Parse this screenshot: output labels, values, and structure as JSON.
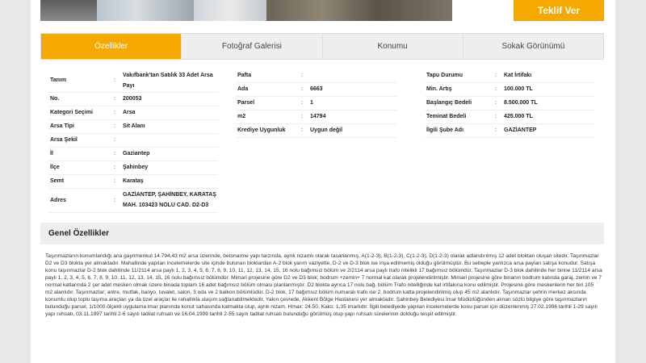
{
  "header": {
    "offer_button": "Teklif Ver"
  },
  "tabs": [
    {
      "label": "Özellikler",
      "active": true
    },
    {
      "label": "Fotoğraf Galerisi",
      "active": false
    },
    {
      "label": "Konumu",
      "active": false
    },
    {
      "label": "Sokak Görünümü",
      "active": false
    }
  ],
  "details_col1": [
    {
      "key": "Tanım",
      "sep": ":",
      "value": "Vakıfbank'tan Satılık 33 Adet Arsa Payı"
    },
    {
      "key": "No.",
      "sep": ":",
      "value": "200053"
    },
    {
      "key": "Kategori Seçimi",
      "sep": ":",
      "value": "Arsa"
    },
    {
      "key": "Arsa Tipi",
      "sep": ":",
      "value": "Sit Alanı"
    },
    {
      "key": "Arsa Şekil",
      "sep": ":",
      "value": ""
    },
    {
      "key": "İl",
      "sep": ":",
      "value": "Gaziantep"
    },
    {
      "key": "İlçe",
      "sep": ":",
      "value": "Şahinbey"
    },
    {
      "key": "Semt",
      "sep": ":",
      "value": "Karataş"
    },
    {
      "key": "Adres",
      "sep": ":",
      "value": "GAZİANTEP, ŞAHİNBEY, KARATAŞ MAH. 103423 NOLU CAD. D2-D3"
    }
  ],
  "details_col2": [
    {
      "key": "Pafta",
      "sep": ":",
      "value": ""
    },
    {
      "key": "Ada",
      "sep": ":",
      "value": "6663"
    },
    {
      "key": "Parsel",
      "sep": ":",
      "value": "1"
    },
    {
      "key": "m2",
      "sep": ":",
      "value": "14794"
    },
    {
      "key": "Krediye Uygunluk",
      "sep": ":",
      "value": "Uygun değil"
    }
  ],
  "details_col3": [
    {
      "key": "Tapu Durumu",
      "sep": ":",
      "value": "Kat İrtifakı"
    },
    {
      "key": "Min. Artış",
      "sep": ":",
      "value": "100.000 TL"
    },
    {
      "key": "Başlangıç Bedeli",
      "sep": ":",
      "value": "8.500.000 TL"
    },
    {
      "key": "Teminat Bedeli",
      "sep": ":",
      "value": "425.000 TL"
    },
    {
      "key": "İlgili Şube Adı",
      "sep": ":",
      "value": "GAZİANTEP"
    }
  ],
  "general": {
    "title": "Genel Özellikler",
    "description": "Taşınmazların konumlandığı ana gayrimenkul 14.794,43 m2 arsa üzerinde, betonarme yapı tarzında, ayrık nizamlı olarak tasarlanmış, A(1-2-3), B(1-2-3), C(1-2-3), D(1-2-3) olarak adlandırılmış 12 adet bloktan oluşan sitedir. Taşınmazlar D2 ve D3 blokta yer almaktadır. Mahallinde yapılan incelemelerde site içinde bulunan bloklardan A-2 blok yarım vaziyette, D-2 ve D-3 blok ise inşa edilmemiş olduğu görülmüştür. Bu sebeple yanlızca arsa payları satışa konudur. Satışa konu taşınmazlar D-2 blok dahilinde 11/2114 arsa paylı 1, 2, 3, 4, 5, 6, 7, 8, 9, 10, 11, 12, 13, 14, 15, 16 nolu bağımsız bölüm ve 2/2114 arsa paylı trafo nitelikli 17 bağımsız bölümdür. Taşınmazlar D-3 blok dahilinde her birine 11/2114 arsa paylı 1, 2, 3, 4, 5, 6, 7, 8, 9, 10, 11, 12, 13, 14, 15, 16 nolu bağımsız bölümdür. Mimari projesine göre D2 ve D3 blok; bodrum +zemin+ 7 normal kat olarak projelendirilmiştir. Mimari projesine göre binanın bodrum katında garaj, zemin ve 7 normal katlarında 2 şer adet mesken olmak üzere binada toplam 16 adet bağımsız bölüm olması planlanmıştır. D2 blokta ayrıca 17 nolu bağ. bölüm Trafo nitelliğinde kat irtifakına konu edilmiştir. Projesine göre meskenlerin her biri 105 m2 alanlıdır. Taşınmazlar; antre, mutfak, banyo, tuvalet, salon, 3 oda ve 2 balkon bölümlüdür. D-2 blok, 17 bağımsız bölüm numaralı trafo ise 2. bodrum katta projelendirilmiş olup 45 m2 alanlıdır. Taşınmazlar şehrin merkez aksında konumlu olup toplu taşıma araçları ya da özel araçlar ile rahatlıkla ulaşım sağlanabilmektedir. Yakın çevrede, Akkent Bölge Hastanesi yer almaktadır. Şahinbey Belediyesi İmar Müdürlüğünden alınan sözlü bilgiye göre taşınmazların bulunduğu parsel, 1/1000 ölçekli uygulama imar planında konut sahasında kalmakta olup, ayrık nizam, Hmax: 24.50, Kaks: 1,35 imarlıdır. İlgili belediyede yapılan incelemelerde konu parsel için düzenlenmiş 27.02.1996 tarihli 1-29 sayılı yapı ruhsatı, 03.11.1997 tarihli 2-6 sayılı tadilat ruhsatı ve 16.04.1999 tarihli 2-55 sayılı tadilat ruhsatı bulunduğu görülmüş olup yapı ruhsatı sürelerinin dolduğu tespit edilmiştir."
  }
}
